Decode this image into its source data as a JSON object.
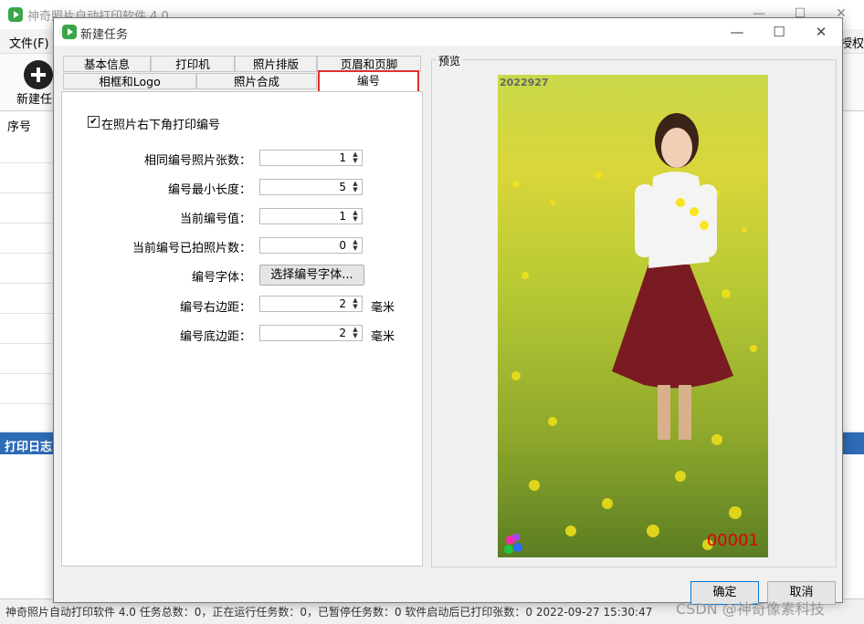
{
  "main_window": {
    "title": "神奇照片自动打印软件 4.0",
    "menu_file": "文件(F)",
    "menu_right_fragment": "授权",
    "new_task_label": "新建任务",
    "table_header_index": "序号",
    "log_title": "打印日志",
    "status_text": "神奇照片自动打印软件 4.0    任务总数：0，正在运行任务数：0，已暂停任务数：0    软件启动后已打印张数：0    2022-09-27 15:30:47"
  },
  "dialog": {
    "title": "新建任务",
    "tabs_row1": [
      "基本信息",
      "打印机",
      "照片排版",
      "页眉和页脚"
    ],
    "tabs_row2": [
      "相框和Logo",
      "照片合成",
      "编号"
    ],
    "active_tab": "编号",
    "checkbox_label": "在照片右下角打印编号",
    "checkbox_checked": true,
    "fields": {
      "same_count_label": "相同编号照片张数：",
      "same_count_value": "1",
      "min_length_label": "编号最小长度：",
      "min_length_value": "5",
      "current_value_label": "当前编号值：",
      "current_value_value": "1",
      "current_shot_label": "当前编号已拍照片数：",
      "current_shot_value": "0",
      "font_label": "编号字体：",
      "font_button": "选择编号字体...",
      "right_margin_label": "编号右边距：",
      "right_margin_value": "2",
      "bottom_margin_label": "编号底边距：",
      "bottom_margin_value": "2",
      "unit": "毫米"
    },
    "preview_title": "预览",
    "preview_stamp": "2022927",
    "preview_number": "00001",
    "ok_button": "确定",
    "cancel_button": "取消"
  },
  "watermark": "CSDN @神奇像素科技",
  "colors": {
    "active_tab_border": "#e03030",
    "log_header": "#2d6bb5",
    "preview_number": "#e00000"
  }
}
